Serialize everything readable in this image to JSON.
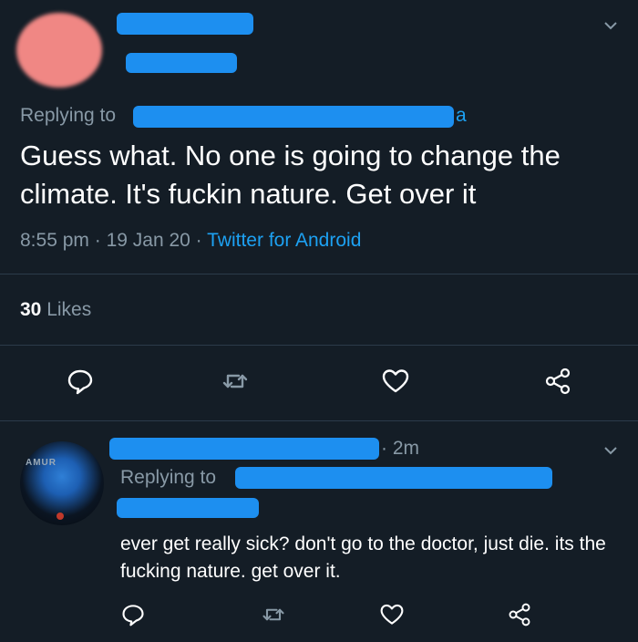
{
  "tweet": {
    "replying_to_label": "Replying to",
    "replying_to_tail": "a",
    "text": "Guess what. No one is going to change the climate. It's fuckin nature. Get over it",
    "time": "8:55 pm",
    "separator": "·",
    "date": "19 Jan 20",
    "source": "Twitter for Android",
    "likes_count": "30",
    "likes_label": "Likes"
  },
  "reply": {
    "avatar_tag": "AMUR",
    "time_ago": "· 2m",
    "replying_to_label": "Replying to",
    "text": "ever get really sick? don't go to the doctor, just die. its the fucking nature. get over it."
  },
  "icons": {
    "reply": "reply-icon",
    "retweet": "retweet-icon",
    "like": "heart-icon",
    "share": "share-icon",
    "menu": "chevron-down-icon"
  },
  "colors": {
    "background": "#141d26",
    "text": "#ffffff",
    "muted": "#8899a6",
    "link": "#1da1f2",
    "redaction": "#1d8ff0"
  }
}
